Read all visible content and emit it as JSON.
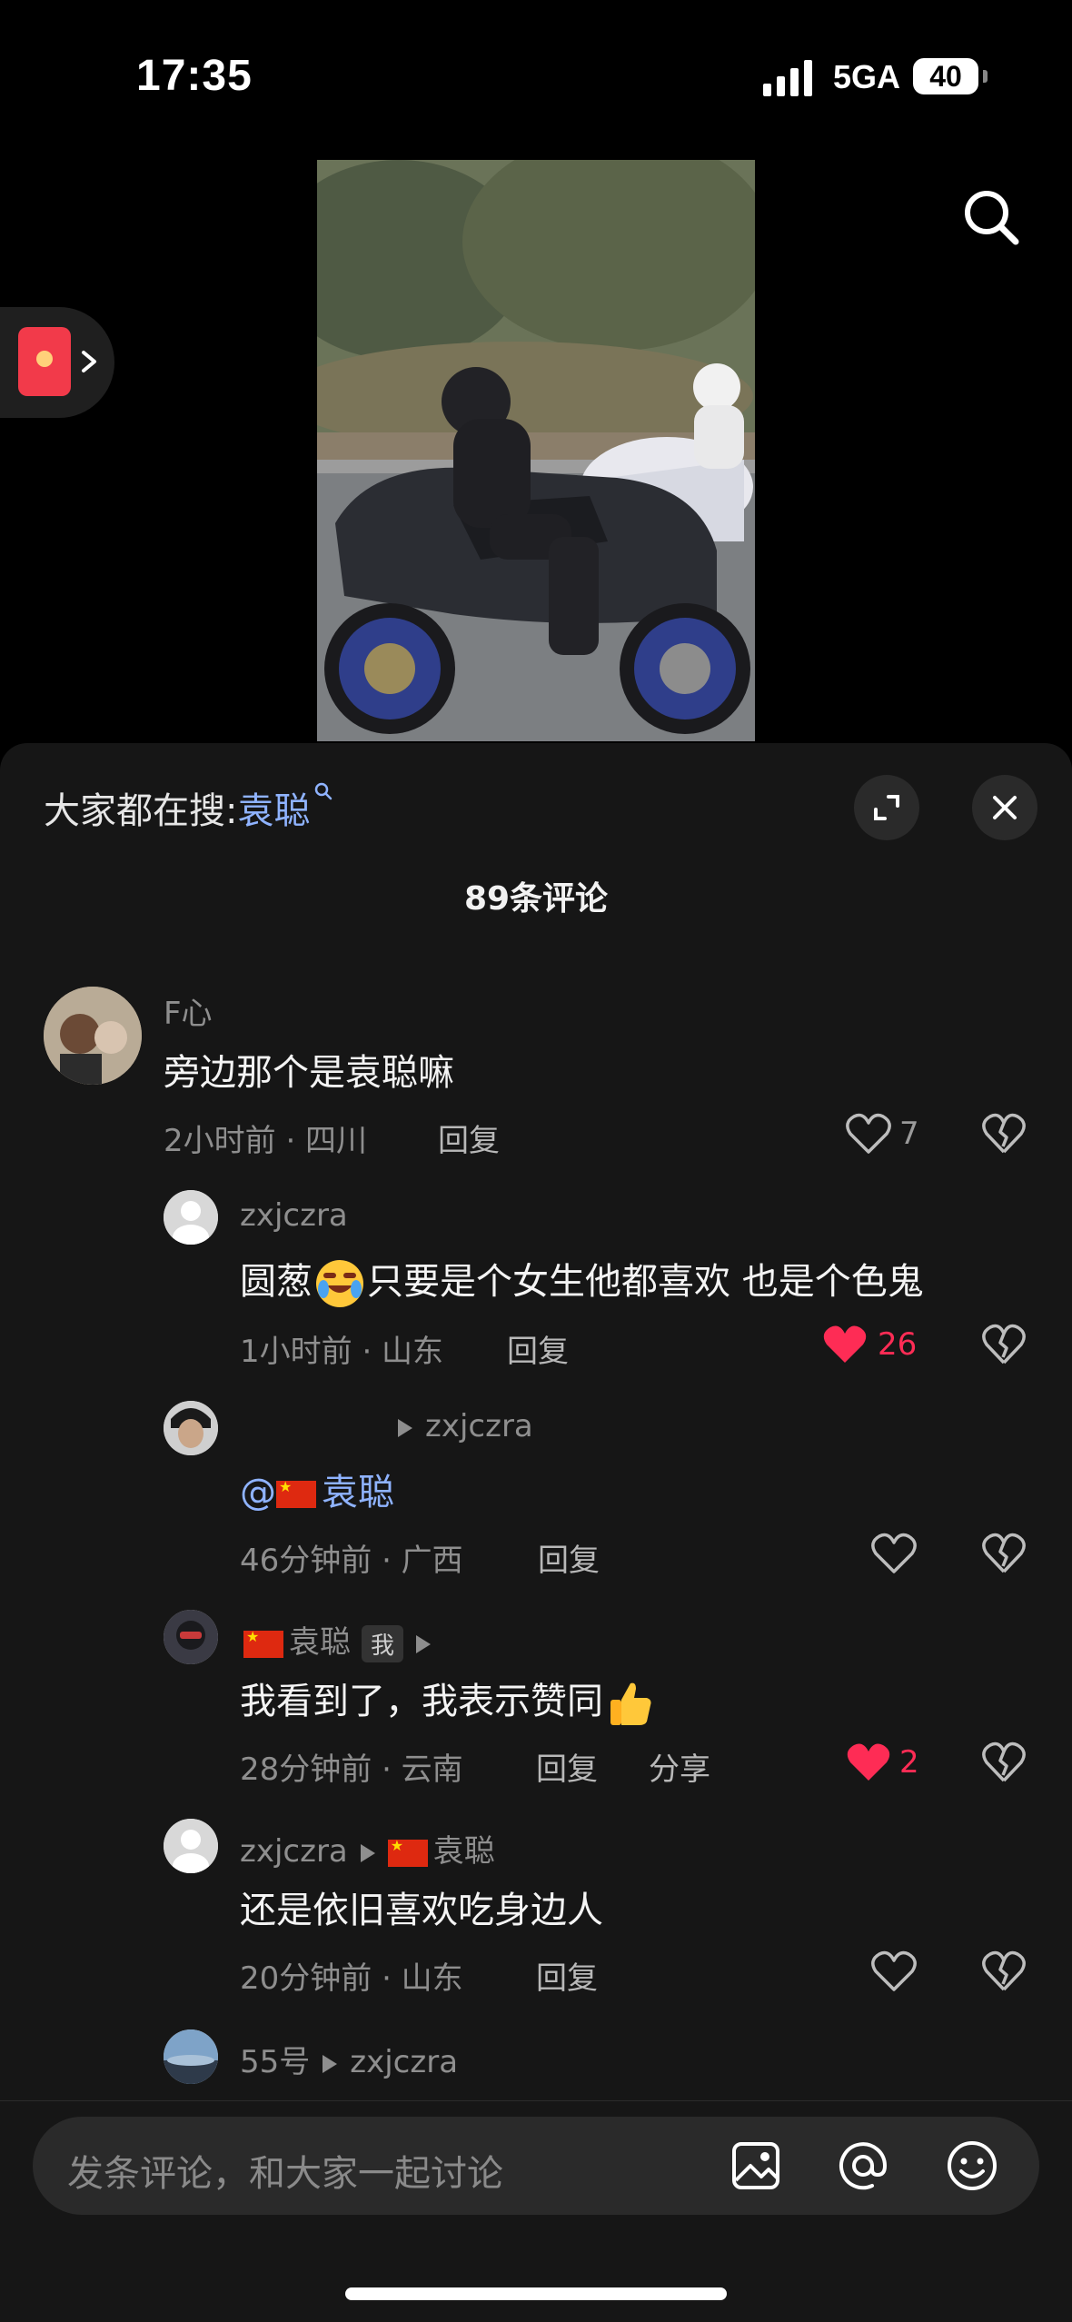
{
  "status_bar": {
    "time": "17:35",
    "network": "5GA",
    "battery": "40"
  },
  "sheet": {
    "search_label": "大家都在搜:",
    "search_keyword": "袁聪",
    "comment_count": "89条评论"
  },
  "comments": [
    {
      "user": "F心",
      "text": "旁边那个是袁聪嘛",
      "meta": "2小时前 · 四川",
      "reply": "回复",
      "likes": "7"
    },
    {
      "user": "zxjczra",
      "text_a": "圆葱",
      "text_b": "只要是个女生他都喜欢 也是个色鬼",
      "meta": "1小时前 · 山东",
      "reply": "回复",
      "likes": "26"
    },
    {
      "reply_to": "zxjczra",
      "mention": "@",
      "mention_name": "袁聪",
      "meta": "46分钟前 · 广西",
      "reply": "回复"
    },
    {
      "user": "袁聪",
      "badge": "我",
      "text": "我看到了，我表示赞同",
      "meta": "28分钟前 · 云南",
      "reply": "回复",
      "share": "分享",
      "likes": "2"
    },
    {
      "user": "zxjczra",
      "reply_to": "袁聪",
      "text": "还是依旧喜欢吃身边人",
      "meta": "20分钟前 · 山东",
      "reply": "回复"
    },
    {
      "user": "55号",
      "reply_to": "zxjczra"
    }
  ],
  "input": {
    "placeholder": "发条评论，和大家一起讨论"
  },
  "icons": {
    "search": "search-icon",
    "expand": "expand-icon",
    "close": "close-icon",
    "like": "heart-icon",
    "dislike": "broken-heart-icon",
    "image": "image-icon",
    "at": "at-icon",
    "emoji": "emoji-icon",
    "red_packet": "red-packet-icon"
  },
  "colors": {
    "accent_red": "#fe2c55",
    "link_blue": "#8fb3ff",
    "sheet_bg": "#161616"
  }
}
